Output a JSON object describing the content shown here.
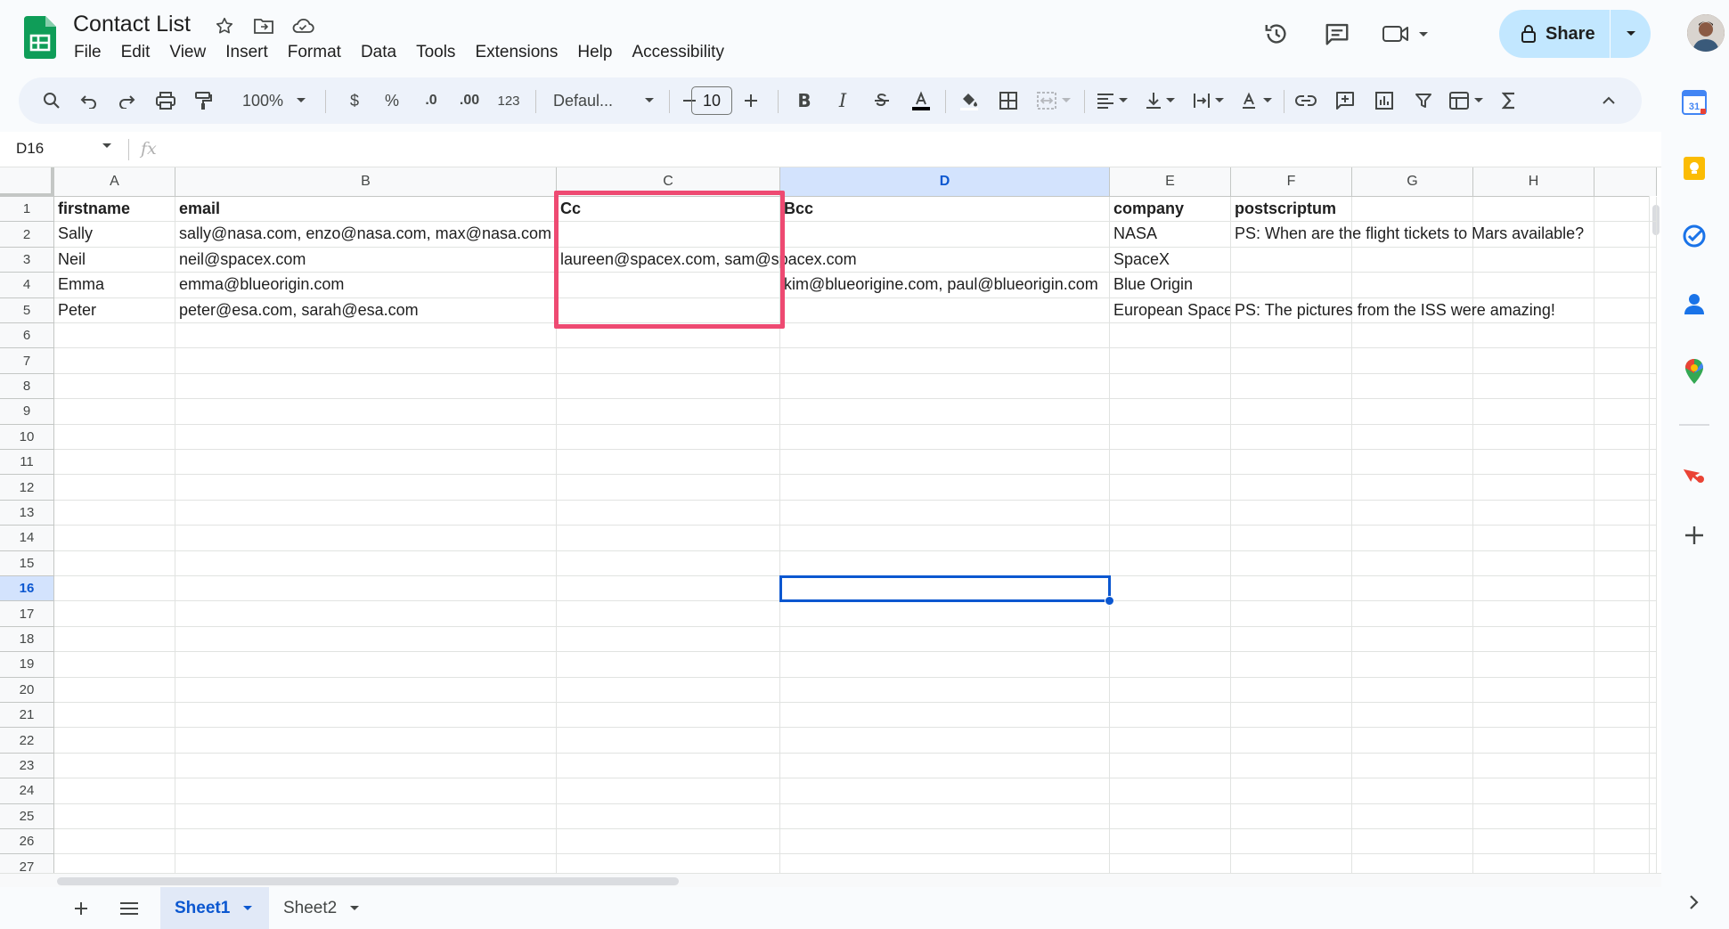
{
  "app": {
    "doc_title": "Contact List",
    "title_icons": [
      "star-icon",
      "move-folder-icon",
      "cloud-status-icon"
    ]
  },
  "menu": [
    "File",
    "Edit",
    "View",
    "Insert",
    "Format",
    "Data",
    "Tools",
    "Extensions",
    "Help",
    "Accessibility"
  ],
  "top_actions": {
    "share_label": "Share",
    "icons": [
      "history-icon",
      "comments-icon",
      "meet-icon"
    ]
  },
  "toolbar": {
    "zoom": "100%",
    "currency": "$",
    "percent": "%",
    "decrease_decimal": ".0",
    "increase_decimal": ".00",
    "more_formats": "123",
    "font": "Defaul...",
    "font_size": "10"
  },
  "formula_bar": {
    "name_box": "D16",
    "fx_label": "fx",
    "formula": ""
  },
  "grid": {
    "columns": [
      "A",
      "B",
      "C",
      "D",
      "E",
      "F",
      "G",
      "H"
    ],
    "active_column": "D",
    "active_row": "16",
    "row_numbers": [
      "1",
      "2",
      "3",
      "4",
      "5",
      "6",
      "7",
      "8",
      "9",
      "10",
      "11",
      "12",
      "13",
      "14",
      "15",
      "16",
      "17",
      "18",
      "19",
      "20",
      "21",
      "22",
      "23",
      "24",
      "25",
      "26",
      "27"
    ],
    "rows": [
      [
        "firstname",
        "email",
        "Cc",
        "Bcc",
        "company",
        "postscriptum",
        "",
        ""
      ],
      [
        "Sally",
        "sally@nasa.com, enzo@nasa.com, max@nasa.com",
        "",
        "",
        "NASA",
        "PS: When are the flight tickets to Mars available?",
        "",
        ""
      ],
      [
        "Neil",
        "neil@spacex.com",
        "laureen@spacex.com, sam@spacex.com",
        "",
        "SpaceX",
        "",
        "",
        ""
      ],
      [
        "Emma",
        "emma@blueorigin.com",
        "",
        "kim@blueorigine.com, paul@blueorigin.com",
        "Blue Origin",
        "",
        "",
        ""
      ],
      [
        "Peter",
        "peter@esa.com, sarah@esa.com",
        "",
        "",
        "European Space Agency",
        "PS: The pictures from the ISS were amazing!",
        "",
        ""
      ]
    ]
  },
  "sheets": {
    "tabs": [
      "Sheet1",
      "Sheet2"
    ],
    "active": "Sheet1"
  },
  "side_panel": {
    "icons": [
      "calendar-icon",
      "keep-icon",
      "tasks-icon",
      "contacts-icon",
      "maps-icon",
      "addon-icon",
      "add-icon"
    ],
    "calendar_day": "31"
  },
  "colors": {
    "accent": "#0b57d0",
    "share_bg": "#c2e7ff",
    "highlight": "#ee4a72",
    "sheets_green": "#0f9d58"
  }
}
